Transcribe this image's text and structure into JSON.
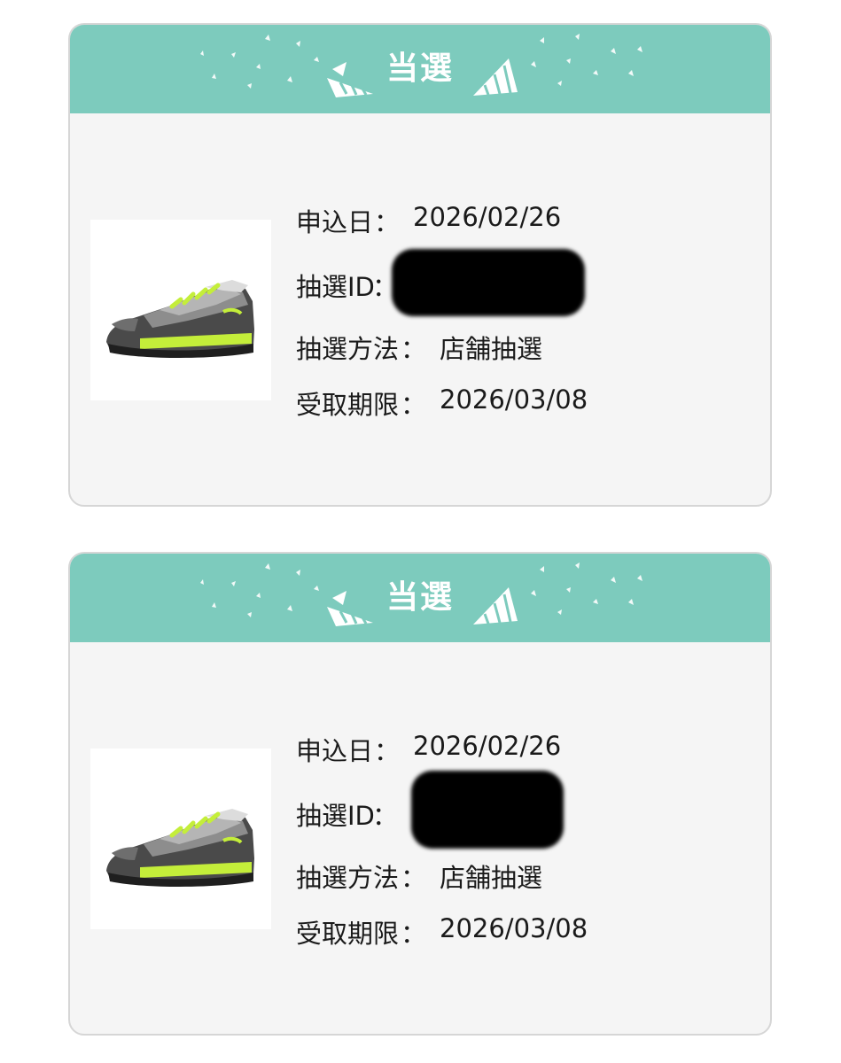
{
  "colors": {
    "banner": "#7dcbbd",
    "card_bg": "#f5f5f5",
    "card_border": "#d6d6d6",
    "text": "#1a1a1a"
  },
  "icons": {
    "product": "sneaker-image",
    "party": "party-horn-icon",
    "confetti": "confetti-icon"
  },
  "cards": [
    {
      "banner_title": "当選",
      "fields": {
        "application_date_label": "申込日",
        "application_date": "2026/02/26",
        "lottery_id_label": "抽選ID",
        "lottery_method_label": "抽選方法",
        "lottery_method": "店舗抽選",
        "pickup_deadline_label": "受取期限",
        "pickup_deadline": "2026/03/08"
      },
      "colon": "："
    },
    {
      "banner_title": "当選",
      "fields": {
        "application_date_label": "申込日",
        "application_date": "2026/02/26",
        "lottery_id_label": "抽選ID",
        "lottery_method_label": "抽選方法",
        "lottery_method": "店舗抽選",
        "pickup_deadline_label": "受取期限",
        "pickup_deadline": "2026/03/08"
      },
      "colon": "："
    }
  ]
}
